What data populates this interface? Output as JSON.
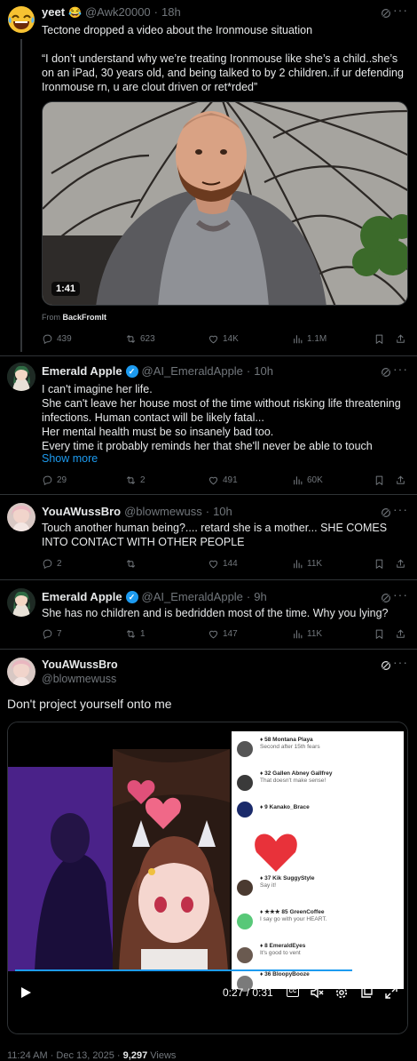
{
  "tweets": [
    {
      "name": "yeet",
      "emoji": "😂",
      "handle": "@Awk20000",
      "time": "18h",
      "text": "Tectone dropped a video about the Ironmouse situation\n\n“I don’t understand why we’re treating Ironmouse like she’s a child..she’s on an iPad, 30 years old, and being talked to by 2 children..if ur defending Ironmouse rn, u are clout driven or ret*rded”",
      "video_duration": "1:41",
      "from_label": "From",
      "from_source": "BackFromIt",
      "replies": "439",
      "reposts": "623",
      "likes": "14K",
      "views": "1.1M"
    },
    {
      "name": "Emerald Apple",
      "handle": "@AI_EmeraldApple",
      "time": "10h",
      "text": "I can't imagine her life.\nShe can't leave her house most of the time without risking life threatening infections. Human contact will be likely fatal...\nHer mental health must be so insanely bad too.\nEvery time it probably reminds her that she'll never be able to touch another",
      "show_more": "Show more",
      "replies": "29",
      "reposts": "2",
      "likes": "491",
      "views": "60K"
    },
    {
      "name": "YouAWussBro",
      "handle": "@blowmewuss",
      "time": "10h",
      "text": "Touch another human being?.... retard she is a mother... SHE COMES INTO CONTACT WITH OTHER PEOPLE",
      "replies": "2",
      "reposts": "",
      "likes": "144",
      "views": "11K"
    },
    {
      "name": "Emerald Apple",
      "handle": "@AI_EmeraldApple",
      "time": "9h",
      "text": "She has no children and is bedridden most of the time. Why you lying?",
      "replies": "7",
      "reposts": "1",
      "likes": "147",
      "views": "11K"
    }
  ],
  "focus": {
    "name": "YouAWussBro",
    "handle": "@blowmewuss",
    "text": "Don't project yourself onto me",
    "video_time": "0:27 / 0:31",
    "cc_label": "CC",
    "chat": [
      {
        "user": "♦ 58 Montana Playa",
        "msg": "Second after 15th fears"
      },
      {
        "user": "♦ 32 Gallen Abney Gallfrey",
        "msg": "That doesn't make sense!"
      },
      {
        "user": "♦ 9 Kanako_Brace",
        "msg": ""
      },
      {
        "user": "♦ 37 Kik SuggyStyle",
        "msg": "Say it!"
      },
      {
        "user": "♦ ★★★ 85 GreenCoffee",
        "msg": "I say go with your HEART."
      },
      {
        "user": "♦ 8 EmeraldEyes",
        "msg": "It's good to vent"
      },
      {
        "user": "♦ 36 BloopyBooze",
        "msg": ""
      }
    ],
    "timestamp": "11:24 AM · Dec 13, 2025 · ",
    "views_count": "9,297",
    "views_label": " Views"
  },
  "colors": {
    "accent": "#1d9bf0",
    "text": "#e7e9ea",
    "muted": "#71767b",
    "border": "#2f3336"
  }
}
